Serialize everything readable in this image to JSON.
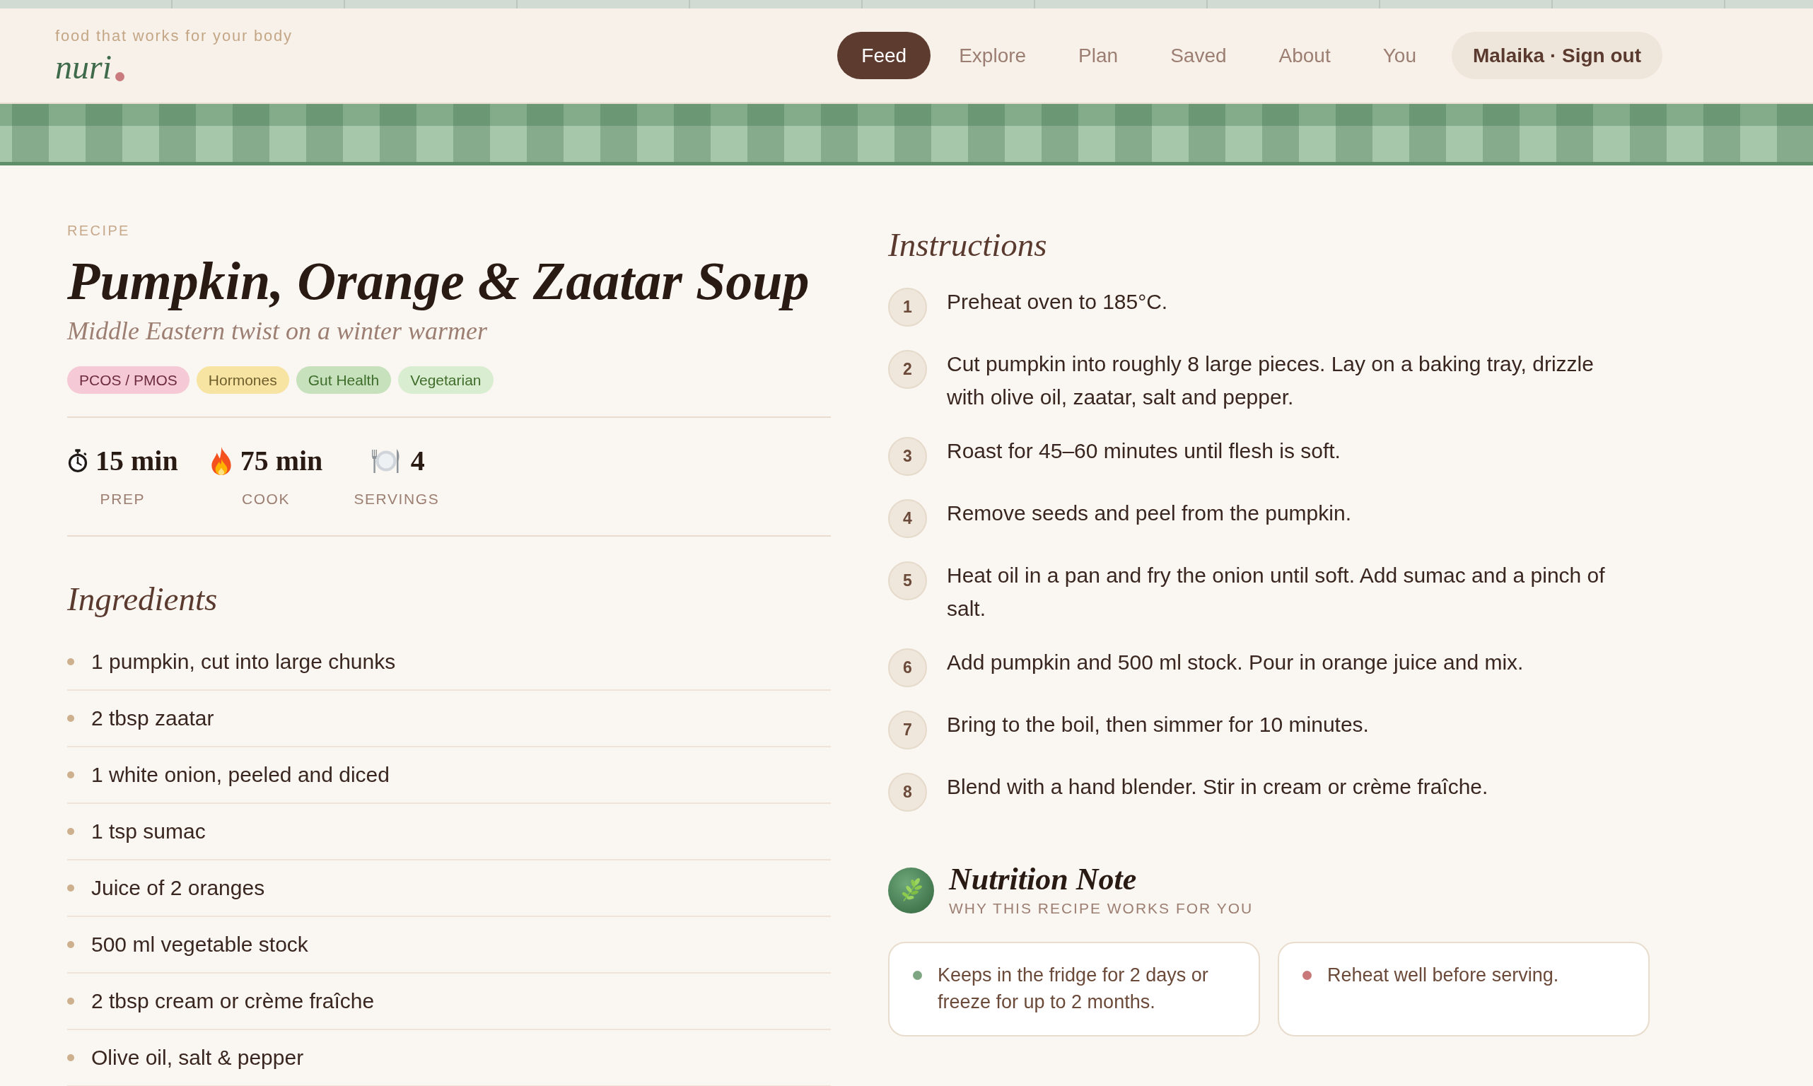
{
  "header": {
    "tagline": "food that works for your body",
    "logo": "nuri"
  },
  "nav": {
    "items": [
      {
        "label": "Feed",
        "selected": true
      },
      {
        "label": "Explore",
        "selected": false
      },
      {
        "label": "Plan",
        "selected": false
      },
      {
        "label": "Saved",
        "selected": false
      },
      {
        "label": "About",
        "selected": false
      },
      {
        "label": "You",
        "selected": false
      }
    ],
    "account": "Malaika · Sign out"
  },
  "recipe": {
    "eyebrow": "RECIPE",
    "title": "Pumpkin, Orange & Zaatar Soup",
    "subtitle": "Middle Eastern twist on a winter warmer",
    "tags": [
      {
        "label": "PCOS / PMOS",
        "color": "#f5cad6"
      },
      {
        "label": "Hormones",
        "color": "#f7e4a3"
      },
      {
        "label": "Gut Health",
        "color": "#c6e1bc"
      },
      {
        "label": "Vegetarian",
        "color": "#d9edd0"
      }
    ],
    "stats": [
      {
        "kind": "stopwatch",
        "value": "15 min",
        "label": "PREP"
      },
      {
        "kind": "flame",
        "value": "75 min",
        "label": "COOK"
      },
      {
        "kind": "plate",
        "value": "4",
        "label": "SERVINGS"
      }
    ]
  },
  "ingredients": {
    "heading": "Ingredients",
    "items": [
      "1 pumpkin, cut into large chunks",
      "2 tbsp zaatar",
      "1 white onion, peeled and diced",
      "1 tsp sumac",
      "Juice of 2 oranges",
      "500 ml vegetable stock",
      "2 tbsp cream or crème fraîche",
      "Olive oil, salt & pepper"
    ]
  },
  "instructions": {
    "heading": "Instructions",
    "steps": [
      {
        "number": "1",
        "text": "Preheat oven to 185°C."
      },
      {
        "number": "2",
        "text": "Cut pumpkin into roughly 8 large pieces. Lay on a baking tray, drizzle with olive oil, zaatar, salt and pepper."
      },
      {
        "number": "3",
        "text": "Roast for 45–60 minutes until flesh is soft."
      },
      {
        "number": "4",
        "text": "Remove seeds and peel from the pumpkin."
      },
      {
        "number": "5",
        "text": "Heat oil in a pan and fry the onion until soft. Add sumac and a pinch of salt."
      },
      {
        "number": "6",
        "text": "Add pumpkin and 500 ml stock. Pour in orange juice and mix."
      },
      {
        "number": "7",
        "text": "Bring to the boil, then simmer for 10 minutes."
      },
      {
        "number": "8",
        "text": "Blend with a hand blender. Stir in cream or crème fraîche."
      }
    ]
  },
  "nutrition_note": {
    "title": "Nutrition Note",
    "subtitle": "WHY THIS RECIPE WORKS FOR YOU",
    "notes": [
      {
        "text": "Keeps in the fridge for 2 days or freeze for up to 2 months.",
        "color": "#7fa683"
      },
      {
        "text": "Reheat well before serving.",
        "color": "#c9787a"
      }
    ]
  }
}
